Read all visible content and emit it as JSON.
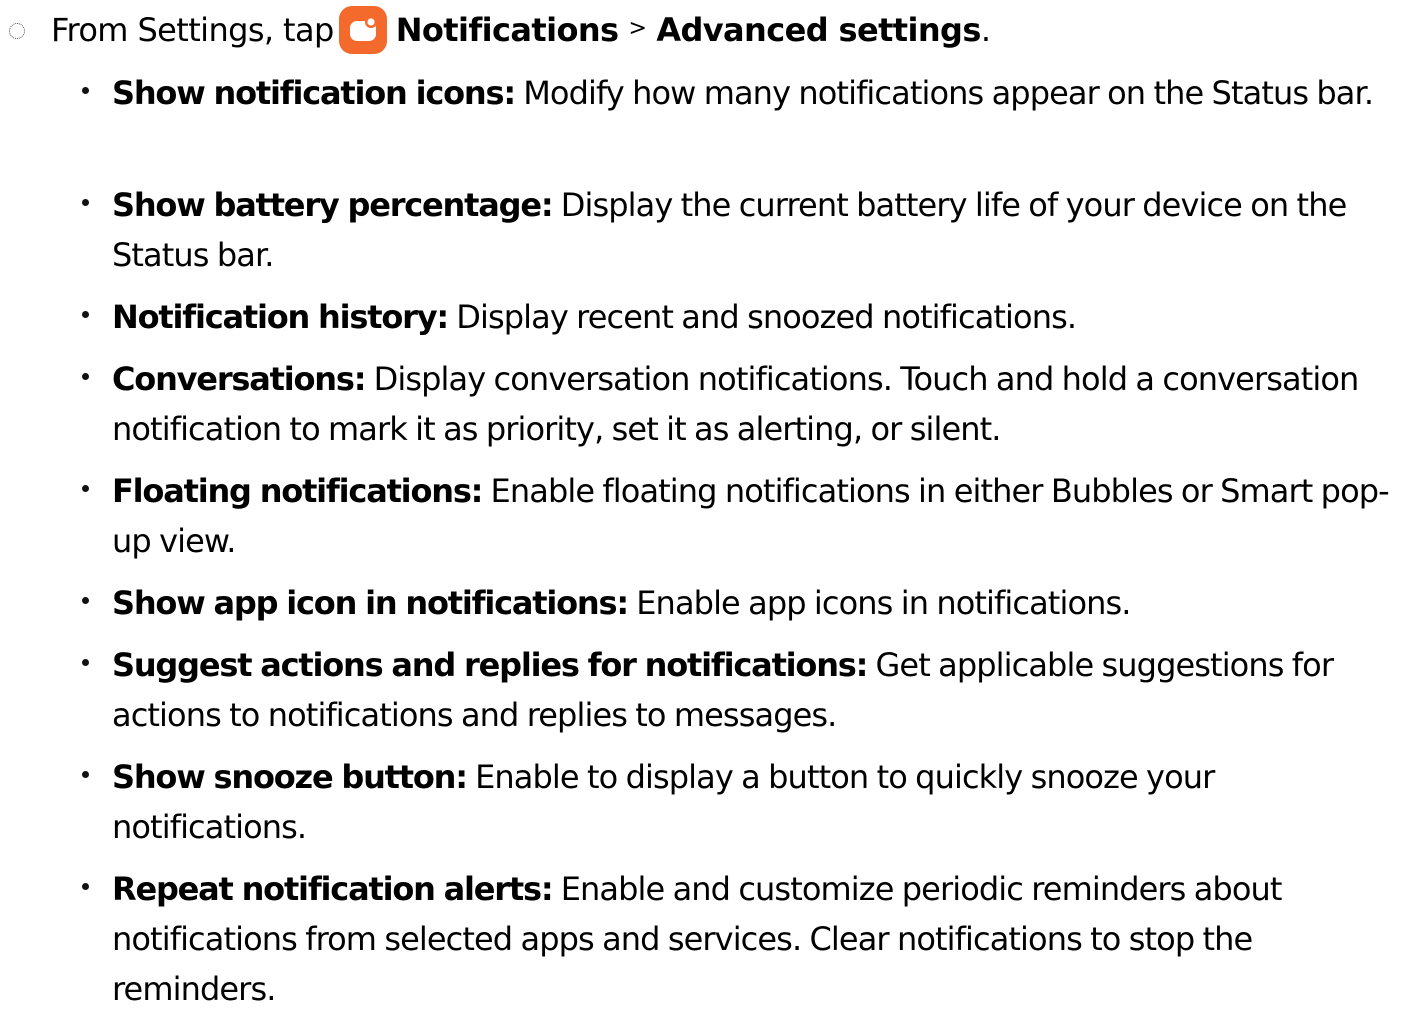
{
  "step": {
    "prefix": "From Settings, tap",
    "app_icon": "notifications-app-icon",
    "app_icon_color": "#f36a2c",
    "menu_item": "Notifications",
    "separator": ">",
    "submenu_item": "Advanced settings",
    "suffix": "."
  },
  "items": [
    {
      "term": "Show notification icons:",
      "desc": " Modify how many notifications appear on the Status bar."
    },
    {
      "term": "Show battery percentage:",
      "desc": " Display the current battery life of your device on the Status bar."
    },
    {
      "term": "Notification history:",
      "desc": " Display recent and snoozed notifications."
    },
    {
      "term": "Conversations:",
      "desc": " Display conversation notifications. Touch and hold a conversation notification to mark it as priority, set it as alerting, or silent."
    },
    {
      "term": "Floating notifications:",
      "desc": " Enable floating notifications in either Bubbles or Smart pop-up view."
    },
    {
      "term": "Show app icon in notifications:",
      "desc": " Enable app icons in notifications."
    },
    {
      "term": "Suggest actions and replies for notifications:",
      "desc": " Get applicable suggestions for actions to notifications and replies to messages."
    },
    {
      "term": "Show snooze button:",
      "desc": " Enable to display a button to quickly snooze your notifications."
    },
    {
      "term": "Repeat notification alerts:",
      "desc": " Enable and customize periodic reminders about notifications from selected apps and services. Clear notifications to stop the reminders."
    }
  ]
}
